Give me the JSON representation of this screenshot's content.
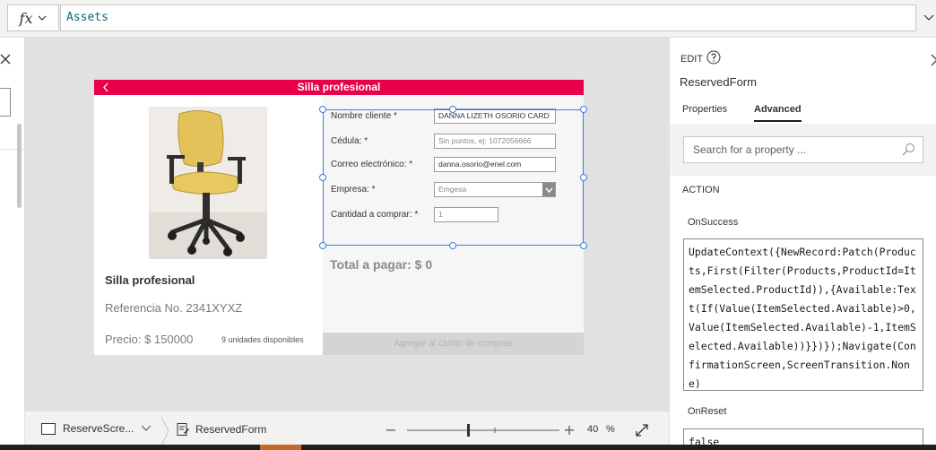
{
  "formula_bar": {
    "fx_label": "fx",
    "value": "Assets"
  },
  "app": {
    "title": "Silla profesional",
    "product": {
      "name": "Silla profesional",
      "reference": "Referencia No. 2341XYXZ",
      "price": "Precio: $ 150000",
      "units": "9 unidades disponibles"
    },
    "form": {
      "fields": [
        {
          "label": "Nombre cliente *",
          "value": "DANNA LIZETH OSORIO CARD",
          "placeholder": false
        },
        {
          "label": "Cédula: *",
          "value": "Sin puntos, ej: 1072056666",
          "placeholder": true
        },
        {
          "label": "Correo electrónico: *",
          "value": "danna.osorio@enel.com",
          "placeholder": false
        },
        {
          "label": "Empresa: *",
          "value": "Emgesa",
          "placeholder": true
        },
        {
          "label": "Cantidad a comprar: *",
          "value": "1",
          "placeholder": true
        }
      ],
      "total": "Total a pagar: $ 0",
      "cart_button": "Agregar al carrito de compras"
    }
  },
  "status_bar": {
    "screen": "ReserveScre...",
    "control": "ReservedForm",
    "zoom": "40",
    "zoom_unit": "%",
    "zoom_level_fraction": 0.4
  },
  "right_panel": {
    "edit_label": "EDIT",
    "title": "ReservedForm",
    "tabs": [
      {
        "label": "Properties",
        "active": false
      },
      {
        "label": "Advanced",
        "active": true
      }
    ],
    "search_placeholder": "Search for a property ...",
    "section": "ACTION",
    "properties": [
      {
        "name": "OnSuccess",
        "value": "UpdateContext({NewRecord:Patch(Products,First(Filter(Products,ProductId=ItemSelected.ProductId)),{Available:Text(If(Value(ItemSelected.Available)>0,Value(ItemSelected.Available)-1,ItemSelected.Available))}})});Navigate(ConfirmationScreen,ScreenTransition.None)"
      },
      {
        "name": "OnReset",
        "value": "false"
      }
    ]
  },
  "colors": {
    "app_header": "#e8004a",
    "selection": "#3b7dd8",
    "formula_text": "#0b6a6f"
  }
}
